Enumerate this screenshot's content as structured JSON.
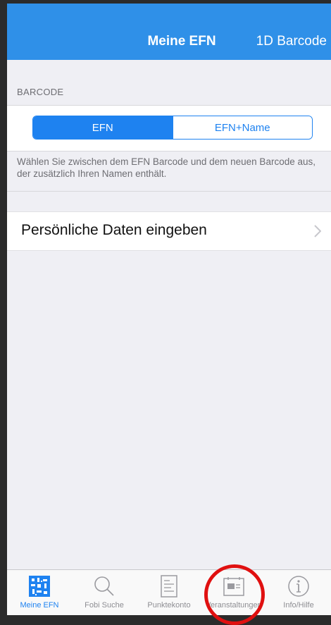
{
  "navbar": {
    "title": "Meine EFN",
    "right_button": "1D Barcode",
    "background": "#2f90e8"
  },
  "barcode_section": {
    "header": "BARCODE",
    "segments": [
      "EFN",
      "EFN+Name"
    ],
    "selected": "EFN",
    "footer": "Wählen Sie zwischen dem EFN Barcode und dem neuen Barcode aus, der zusätzlich Ihren Namen enthält."
  },
  "personal_row": {
    "label": "Persönliche Daten eingeben",
    "accessory": "chevron-right-icon"
  },
  "tabbar": {
    "items": [
      {
        "label": "Meine EFN",
        "icon": "barcode-icon",
        "active": true
      },
      {
        "label": "Fobi Suche",
        "icon": "search-icon",
        "active": false
      },
      {
        "label": "Punktekonto",
        "icon": "document-icon",
        "active": false
      },
      {
        "label": "Veranstaltungen",
        "icon": "calendar-card-icon",
        "active": false
      },
      {
        "label": "Info/Hilfe",
        "icon": "info-icon",
        "active": false
      }
    ]
  },
  "colors": {
    "accent": "#1e82f0",
    "highlight": "#e01010"
  }
}
